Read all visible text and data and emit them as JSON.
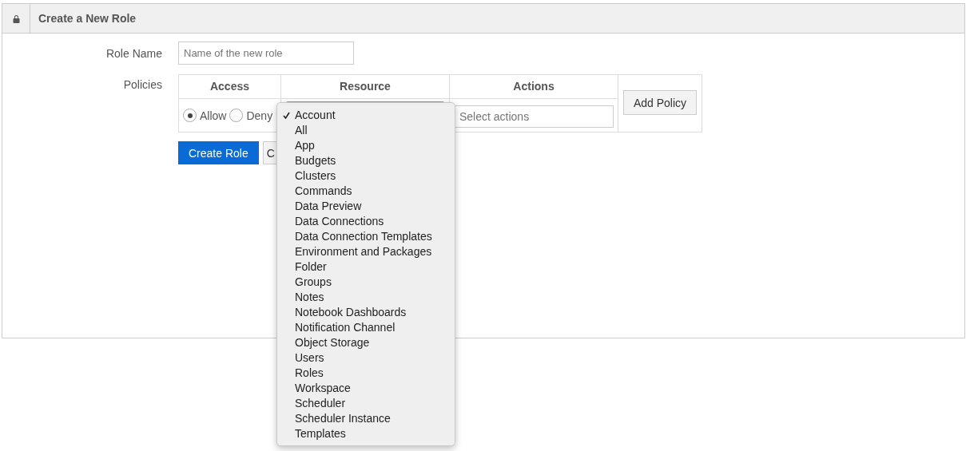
{
  "panel": {
    "title": "Create a New Role"
  },
  "role_name": {
    "label": "Role Name",
    "placeholder": "Name of the new role"
  },
  "policies": {
    "label": "Policies",
    "columns": [
      "Access",
      "Resource",
      "Actions"
    ],
    "access_options": [
      {
        "label": "Allow",
        "selected": true
      },
      {
        "label": "Deny",
        "selected": false
      }
    ],
    "actions_placeholder": "Select actions",
    "add_button": "Add Policy"
  },
  "buttons": [
    {
      "label": "Create Role",
      "kind": "primary"
    },
    {
      "label": "C",
      "kind": "default"
    }
  ],
  "resource_menu": [
    {
      "label": "Account",
      "selected": true
    },
    {
      "label": "All",
      "selected": false
    },
    {
      "label": "App",
      "selected": false
    },
    {
      "label": "Budgets",
      "selected": false
    },
    {
      "label": "Clusters",
      "selected": false
    },
    {
      "label": "Commands",
      "selected": false
    },
    {
      "label": "Data Preview",
      "selected": false
    },
    {
      "label": "Data Connections",
      "selected": false
    },
    {
      "label": "Data Connection Templates",
      "selected": false
    },
    {
      "label": "Environment and Packages",
      "selected": false
    },
    {
      "label": "Folder",
      "selected": false
    },
    {
      "label": "Groups",
      "selected": false
    },
    {
      "label": "Notes",
      "selected": false
    },
    {
      "label": "Notebook Dashboards",
      "selected": false
    },
    {
      "label": "Notification Channel",
      "selected": false
    },
    {
      "label": "Object Storage",
      "selected": false
    },
    {
      "label": "Users",
      "selected": false
    },
    {
      "label": "Roles",
      "selected": false
    },
    {
      "label": "Workspace",
      "selected": false
    },
    {
      "label": "Scheduler",
      "selected": false
    },
    {
      "label": "Scheduler Instance",
      "selected": false
    },
    {
      "label": "Templates",
      "selected": false
    }
  ]
}
